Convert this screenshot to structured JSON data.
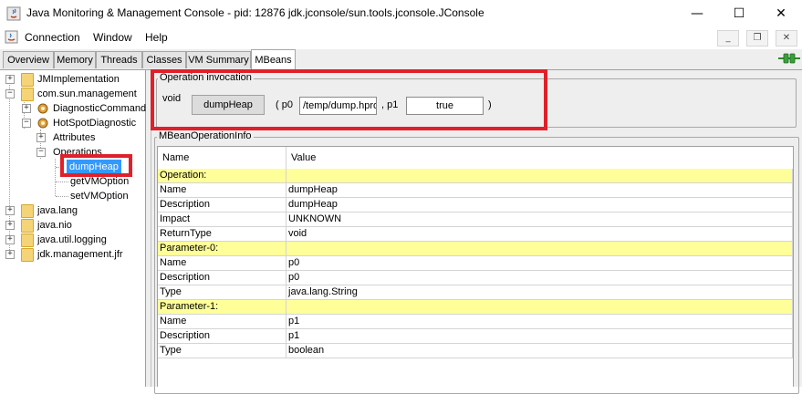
{
  "window": {
    "title": "Java Monitoring & Management Console - pid: 12876 jdk.jconsole/sun.tools.jconsole.JConsole",
    "minimize": "—",
    "maximize": "☐",
    "close": "✕"
  },
  "menu": {
    "items": [
      "Connection",
      "Window",
      "Help"
    ]
  },
  "mdi": {
    "minimize": "_",
    "restore": "❐",
    "close": "✕"
  },
  "tabs": [
    "Overview",
    "Memory",
    "Threads",
    "Classes",
    "VM Summary",
    "MBeans"
  ],
  "tree": {
    "jmimplementation": "JMImplementation",
    "com_sun_management": "com.sun.management",
    "diagnostic_command": "DiagnosticCommand",
    "hotspot_diagnostic": "HotSpotDiagnostic",
    "attributes": "Attributes",
    "operations": "Operations",
    "dump_heap": "dumpHeap",
    "get_vm_option": "getVMOption",
    "set_vm_option": "setVMOption",
    "java_lang": "java.lang",
    "java_nio": "java.nio",
    "java_util_logging": "java.util.logging",
    "jdk_management_jfr": "jdk.management.jfr"
  },
  "operation": {
    "group_title": "Operation invocation",
    "return_type": "void",
    "button_label": "dumpHeap",
    "open_paren": "( p0",
    "p0_value": "/temp/dump.hprof",
    "sep_p1": ", p1",
    "p1_value": "true",
    "close_paren": ")"
  },
  "info": {
    "group_title": "MBeanOperationInfo",
    "headers": [
      "Name",
      "Value"
    ],
    "rows": [
      {
        "name": "Operation:",
        "value": "",
        "section": true
      },
      {
        "name": "Name",
        "value": "dumpHeap",
        "section": false
      },
      {
        "name": "Description",
        "value": "dumpHeap",
        "section": false
      },
      {
        "name": "Impact",
        "value": "UNKNOWN",
        "section": false
      },
      {
        "name": "ReturnType",
        "value": "void",
        "section": false
      },
      {
        "name": "Parameter-0:",
        "value": "",
        "section": true
      },
      {
        "name": "Name",
        "value": "p0",
        "section": false
      },
      {
        "name": "Description",
        "value": "p0",
        "section": false
      },
      {
        "name": "Type",
        "value": "java.lang.String",
        "section": false
      },
      {
        "name": "Parameter-1:",
        "value": "",
        "section": true
      },
      {
        "name": "Name",
        "value": "p1",
        "section": false
      },
      {
        "name": "Description",
        "value": "p1",
        "section": false
      },
      {
        "name": "Type",
        "value": "boolean",
        "section": false
      }
    ]
  },
  "colors": {
    "highlight": "#e0202a",
    "section_row": "#ffff99",
    "selection": "#3399ff"
  }
}
